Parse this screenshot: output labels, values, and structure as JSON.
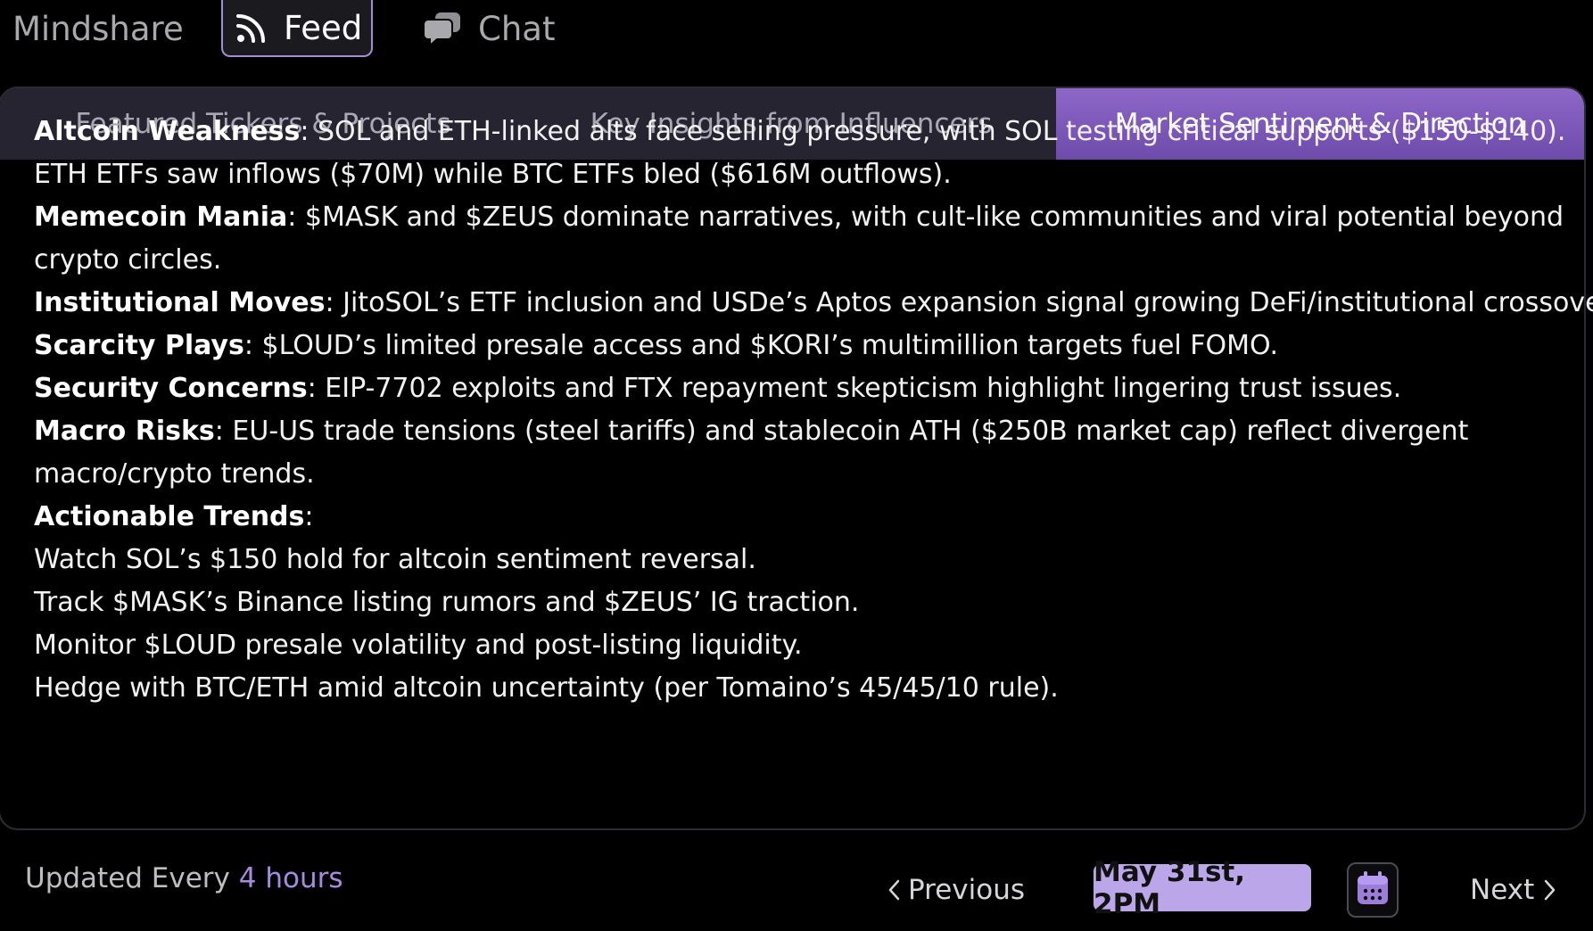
{
  "top_nav": {
    "items": [
      {
        "label": "Mindshare",
        "icon": null,
        "active": false
      },
      {
        "label": "Feed",
        "icon": "rss-icon",
        "active": true
      },
      {
        "label": "Chat",
        "icon": "chat-bubbles-icon",
        "active": false
      }
    ]
  },
  "tabs": [
    {
      "label": "Featured Tickers & Projects",
      "active": false
    },
    {
      "label": "Key Insights from Influencers",
      "active": false
    },
    {
      "label": "Market Sentiment & Direction",
      "active": true
    }
  ],
  "content": {
    "sections": [
      {
        "label": "Altcoin Weakness",
        "text": ": SOL and ETH-linked alts face selling pressure, with SOL testing critical supports ($150-$140)."
      },
      {
        "label": "",
        "text": "ETH ETFs saw inflows ($70M) while BTC ETFs bled ($616M outflows)."
      },
      {
        "label": "Memecoin Mania",
        "text": ": $MASK and $ZEUS dominate narratives, with cult-like communities and viral potential beyond"
      },
      {
        "label": "",
        "text": "crypto circles."
      },
      {
        "label": "Institutional Moves",
        "text": ": JitoSOL’s ETF inclusion and USDe’s Aptos expansion signal growing DeFi/institutional crossover."
      },
      {
        "label": "Scarcity Plays",
        "text": ": $LOUD’s limited presale access and $KORI’s multimillion targets fuel FOMO."
      },
      {
        "label": "Security Concerns",
        "text": ": EIP-7702 exploits and FTX repayment skepticism highlight lingering trust issues."
      },
      {
        "label": "Macro Risks",
        "text": ": EU-US trade tensions (steel tariffs) and stablecoin ATH ($250B market cap) reflect divergent"
      },
      {
        "label": "",
        "text": "macro/crypto trends."
      },
      {
        "label": "Actionable Trends",
        "text": ":"
      },
      {
        "label": "",
        "text": "Watch SOL’s $150 hold for altcoin sentiment reversal."
      },
      {
        "label": "",
        "text": "Track $MASK’s Binance listing rumors and $ZEUS’ IG traction."
      },
      {
        "label": "",
        "text": "Monitor $LOUD presale volatility and post-listing liquidity."
      },
      {
        "label": "",
        "text": "Hedge with BTC/ETH amid altcoin uncertainty (per Tomaino’s 45/45/10 rule)."
      }
    ]
  },
  "footer": {
    "updated_prefix": "Updated Every",
    "updated_interval": "4 hours",
    "previous_label": "Previous",
    "date_label": "May 31st, 2PM",
    "next_label": "Next",
    "calendar_icon": "calendar-icon"
  },
  "colors": {
    "accent": "#a98ae0",
    "active_tab": "#7d58b8",
    "date_badge": "#bca6ea",
    "tab_bar": "#252430",
    "background": "#000000"
  }
}
